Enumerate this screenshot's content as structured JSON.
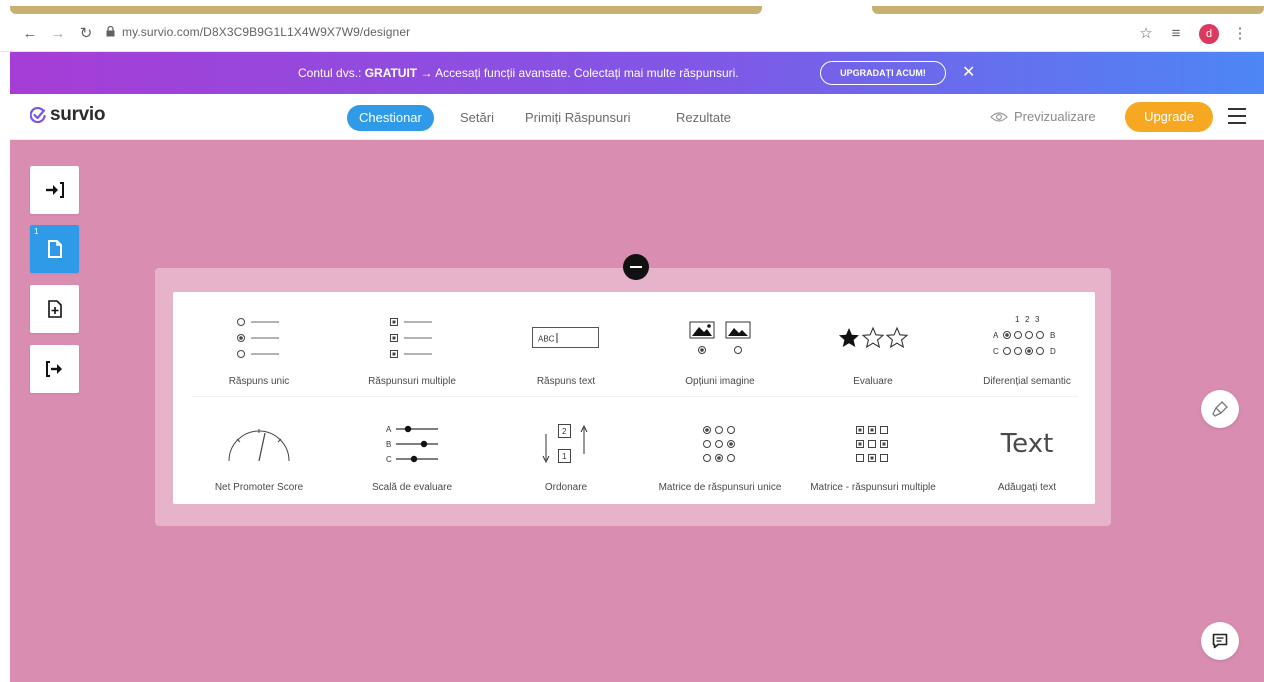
{
  "browser": {
    "url": "my.survio.com/D8X3C9B9G1L1X4W9X7W9/designer",
    "avatar_letter": "d",
    "icons": [
      "back-icon",
      "forward-icon",
      "reload-icon",
      "lock-icon",
      "star-icon",
      "reading-list-icon",
      "kebab-menu-icon"
    ]
  },
  "promo": {
    "text_prefix": "Contul dvs.: ",
    "text_plan": "GRATUIT",
    "text_suffix": " → Accesați funcții avansate. Colectați mai multe răspunsuri.",
    "button_label": "UPGRADAȚI ACUM!",
    "close_glyph": "✕"
  },
  "header": {
    "logo_text": "survio",
    "tabs": [
      {
        "label": "Chestionar",
        "active": true
      },
      {
        "label": "Setări",
        "active": false
      },
      {
        "label": "Primiți Răspunsuri",
        "active": false
      },
      {
        "label": "Rezultate",
        "active": false
      }
    ],
    "preview_label": "Previzualizare",
    "upgrade_label": "Upgrade"
  },
  "sidebar": {
    "page_number": "1",
    "buttons": [
      "intro-page",
      "question-page",
      "add-page",
      "end-page"
    ]
  },
  "question_types": [
    {
      "label": "Răspuns unic",
      "icon": "single-choice-icon"
    },
    {
      "label": "Răspunsuri multiple",
      "icon": "multiple-choice-icon"
    },
    {
      "label": "Răspuns text",
      "icon": "text-answer-icon",
      "sample": "ABC"
    },
    {
      "label": "Opțiuni imagine",
      "icon": "image-choice-icon"
    },
    {
      "label": "Evaluare",
      "icon": "star-rating-icon"
    },
    {
      "label": "Diferențial semantic",
      "icon": "semantic-differential-icon",
      "scale": [
        "1",
        "2",
        "3"
      ],
      "left": [
        "A",
        "C"
      ],
      "right": [
        "B",
        "D"
      ]
    },
    {
      "label": "Net Promoter Score",
      "icon": "nps-gauge-icon"
    },
    {
      "label": "Scală de evaluare",
      "icon": "rating-scale-icon",
      "rows": [
        "A",
        "B",
        "C"
      ]
    },
    {
      "label": "Ordonare",
      "icon": "ranking-icon",
      "numbers": [
        "2",
        "1"
      ]
    },
    {
      "label": "Matrice de răspunsuri unice",
      "icon": "single-matrix-icon"
    },
    {
      "label": "Matrice - răspunsuri multiple",
      "icon": "multiple-matrix-icon"
    },
    {
      "label": "Adăugați text",
      "icon": "add-text-icon",
      "sample": "Text"
    }
  ],
  "colors": {
    "canvas": "#d98db1",
    "accent": "#2f9be8",
    "upgrade": "#f7a823",
    "promo_start": "#a63dd6",
    "promo_end": "#4d86f5"
  }
}
